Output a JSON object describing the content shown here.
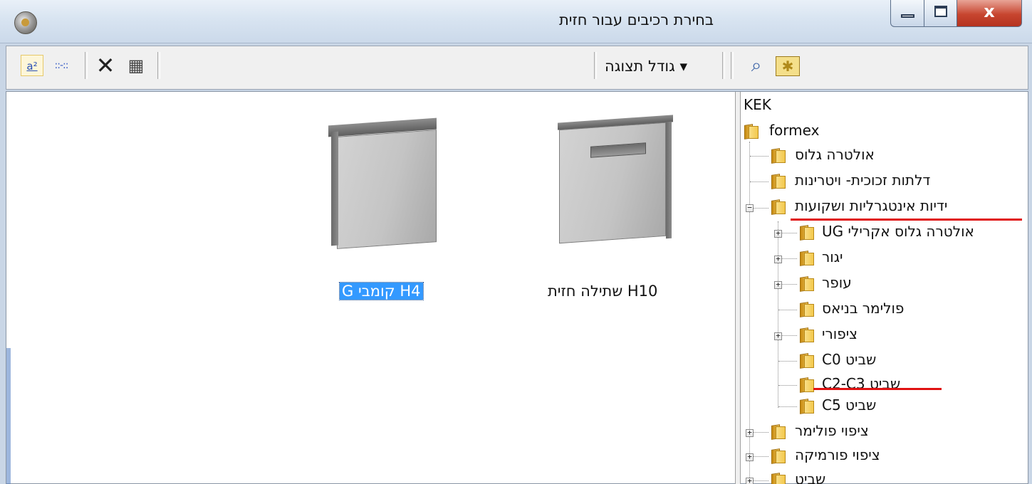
{
  "window": {
    "title": "בחירת רכיבים עבור חזית",
    "minimize_glyph": "",
    "close_glyph": "x"
  },
  "toolbar": {
    "large_icons_glyph": "a²",
    "list_glyph": "::-::",
    "delete_glyph": "✕",
    "properties_glyph": "▦",
    "view_size_label": "גודל תצוגה",
    "view_size_arrow": "▾",
    "search_glyph": "⌕",
    "new_glyph": "✱"
  },
  "items": [
    {
      "label": "H10 שתילה חזית",
      "selected": false
    },
    {
      "label": "H4 קומבי G",
      "selected": true
    }
  ],
  "tree": {
    "root": "KEK",
    "nodes": [
      {
        "label": "formex",
        "expander": ""
      },
      {
        "label": "אולטרה גלוס",
        "expander": ""
      },
      {
        "label": "דלתות זכוכית- ויטרינות",
        "expander": ""
      },
      {
        "label": "ידיות אינטגרליות ושקועות",
        "expander": "−"
      },
      {
        "label": "אולטרה גלוס אקרילי UG",
        "expander": "+"
      },
      {
        "label": "יגור",
        "expander": "+"
      },
      {
        "label": "עופר",
        "expander": "+"
      },
      {
        "label": "פולימר בניאס",
        "expander": ""
      },
      {
        "label": "ציפורי",
        "expander": "+"
      },
      {
        "label": "שביט C0",
        "expander": ""
      },
      {
        "label": "שביט C2-C3",
        "expander": ""
      },
      {
        "label": "שביט C5",
        "expander": ""
      },
      {
        "label": "ציפוי פולימר",
        "expander": "+"
      },
      {
        "label": "ציפוי פורמיקה",
        "expander": "+"
      },
      {
        "label": "שביט",
        "expander": "+"
      }
    ]
  },
  "colors": {
    "highlight_underline": "#e01212",
    "selection": "#3399ff"
  }
}
